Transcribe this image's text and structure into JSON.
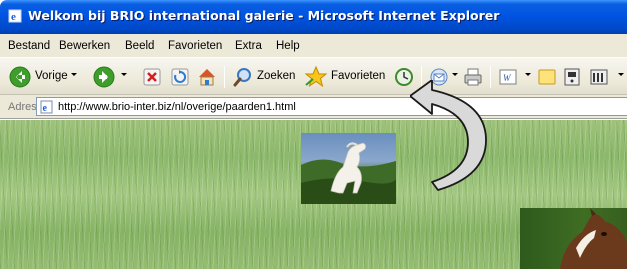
{
  "window": {
    "title": "Welkom bij BRIO international galerie - Microsoft Internet Explorer"
  },
  "menu": {
    "items": [
      "Bestand",
      "Bewerken",
      "Beeld",
      "Favorieten",
      "Extra",
      "Help"
    ]
  },
  "toolbar": {
    "back_label": "Vorige",
    "search_label": "Zoeken",
    "favorites_label": "Favorieten"
  },
  "address": {
    "label": "Adres",
    "url": "http://www.brio-inter.biz/nl/overige/paarden1.html"
  },
  "content": {
    "images": [
      "white-horse-rearing",
      "brown-horse-head"
    ],
    "overlay": "curved-arrow-pointing-to-address-bar"
  },
  "colors": {
    "titlebar": "#0054e3",
    "chrome": "#ece9d8",
    "grass": "#8bb86a"
  }
}
